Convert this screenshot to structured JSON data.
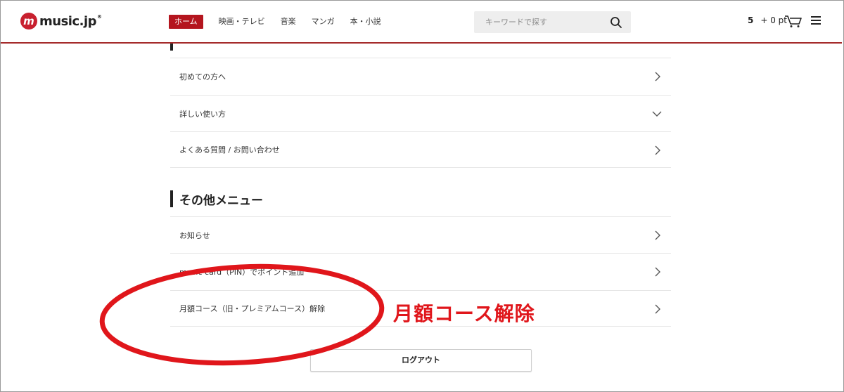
{
  "header": {
    "logo_mark": "m",
    "logo_text": "music.jp",
    "logo_reg": "®",
    "nav": [
      {
        "label": "ホーム",
        "active": true
      },
      {
        "label": "映画・テレビ",
        "active": false
      },
      {
        "label": "音楽",
        "active": false
      },
      {
        "label": "マンガ",
        "active": false
      },
      {
        "label": "本・小説",
        "active": false
      }
    ],
    "search": {
      "placeholder": "キーワードで探す",
      "value": ""
    },
    "points": {
      "main": "5",
      "extra": "+ 0 pt"
    },
    "icons": {
      "search": "search-icon",
      "cart": "cart-icon",
      "menu": "hamburger-menu-icon"
    }
  },
  "help_section": {
    "items": [
      {
        "label": "初めての方へ",
        "icon": "chevron-right-icon"
      },
      {
        "label": "詳しい使い方",
        "icon": "chevron-down-icon"
      },
      {
        "label": "よくある質問 / お問い合わせ",
        "icon": "chevron-right-icon"
      }
    ]
  },
  "other_section": {
    "title": "その他メニュー",
    "items": [
      {
        "label": "お知らせ",
        "icon": "chevron-right-icon"
      },
      {
        "label": "music card（PIN）でポイント追加",
        "icon": "chevron-right-icon"
      },
      {
        "label": "月額コース（旧・プレミアムコース）解除",
        "icon": "chevron-right-icon"
      }
    ]
  },
  "logout_label": "ログアウト",
  "annotation": {
    "label": "月額コース解除",
    "color": "#e0161b"
  },
  "colors": {
    "brand": "#c8202f",
    "header_border": "#a52a2a",
    "nav_active": "#b4151e"
  }
}
